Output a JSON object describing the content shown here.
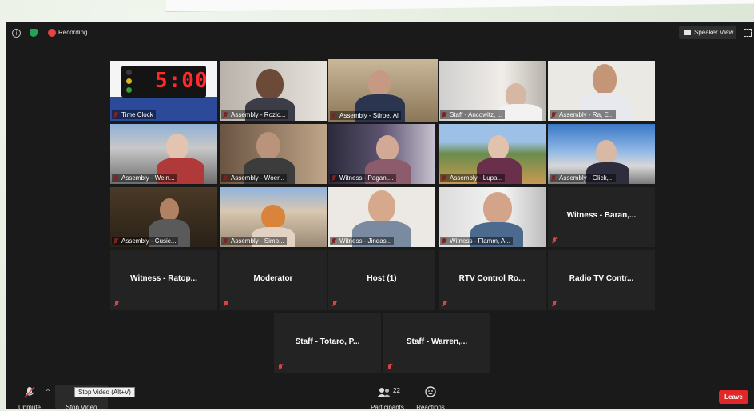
{
  "topbar": {
    "recording_label": "Recording",
    "speaker_view_label": "Speaker View"
  },
  "tiles": [
    {
      "label": "Time Clock",
      "clock": "5:00"
    },
    {
      "label": "Assembly - Rozic..."
    },
    {
      "label": "Assembly - Stirpe, Al"
    },
    {
      "label": "Staff - Ancowitz, ..."
    },
    {
      "label": "Assembly - Ra, E..."
    },
    {
      "label": "Assembly - Wein..."
    },
    {
      "label": "Assembly - Woer..."
    },
    {
      "label": "Witness - Pagan,..."
    },
    {
      "label": "Assembly - Lupa..."
    },
    {
      "label": "Assembly - Glick,..."
    },
    {
      "label": "Assembly - Cusic..."
    },
    {
      "label": "Assembly - Simo..."
    },
    {
      "label": "Witness - Jindas..."
    },
    {
      "label": "Witness - Flamm, A..."
    },
    {
      "label": "Witness - Baran,..."
    },
    {
      "label": "Witness - Ratop..."
    },
    {
      "label": "Moderator"
    },
    {
      "label": "Host (1)"
    },
    {
      "label": "RTV Control Ro..."
    },
    {
      "label": "Radio TV Contr..."
    },
    {
      "label": "Staff - Totaro, P..."
    },
    {
      "label": "Staff - Warren,..."
    }
  ],
  "toolbar": {
    "unmute_label": "Unmute",
    "stop_video_label": "Stop Video",
    "stop_video_tooltip": "Stop Video (Alt+V)",
    "participants_label": "Participants",
    "participants_count": "22",
    "reactions_label": "Reactions",
    "leave_label": "Leave"
  },
  "colors": {
    "leave": "#e02828",
    "mute_icon": "#e04141",
    "active_speaker": "#e3e35a",
    "recording_dot": "#e64343",
    "shield": "#23a455"
  }
}
